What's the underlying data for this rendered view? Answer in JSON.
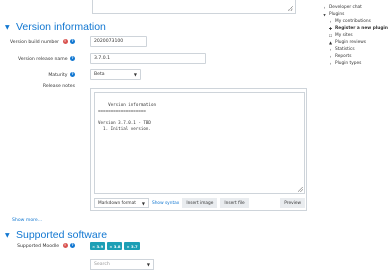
{
  "version_section": {
    "title": "Version information"
  },
  "fields": {
    "build_number": {
      "label": "Version build number",
      "value": "2020073100"
    },
    "release_name": {
      "label": "Version release name",
      "value": "3.7.0.1"
    },
    "maturity": {
      "label": "Maturity",
      "value": "Beta"
    },
    "release_notes": {
      "label": "Release notes",
      "content": "Version information\n===================\n\nVersion 3.7.0.1 - TBD\n  1. Initial version."
    }
  },
  "editor_toolbar": {
    "format": "Markdown format",
    "show_syntax": "Show syntax",
    "insert_image": "Insert image",
    "insert_file": "Insert file",
    "preview": "Preview"
  },
  "show_more": "Show more...",
  "supported_section": {
    "title": "Supported software",
    "moodle_label": "Supported Moodle",
    "chips": [
      "× 3.9",
      "× 3.8",
      "× 3.7"
    ],
    "search_placeholder": "Search"
  },
  "sidebar": {
    "developer_chat": "Developer chat",
    "plugins": "Plugins",
    "my_contributions": "My contributions",
    "register_new_plugin": "Register a new plugin",
    "my_sites": "My sites",
    "plugin_reviews": "Plugin reviews",
    "statistics": "Statistics",
    "reports": "Reports",
    "plugin_types": "Plugin types"
  },
  "colors": {
    "accent": "#1177d1",
    "required": "#d9534f",
    "chip": "#1d9fb5"
  },
  "icons": [
    "help-icon",
    "required-icon",
    "chevron-down-icon",
    "chevron-right-icon",
    "plus-icon",
    "edit-icon",
    "thumbs-up-icon"
  ]
}
